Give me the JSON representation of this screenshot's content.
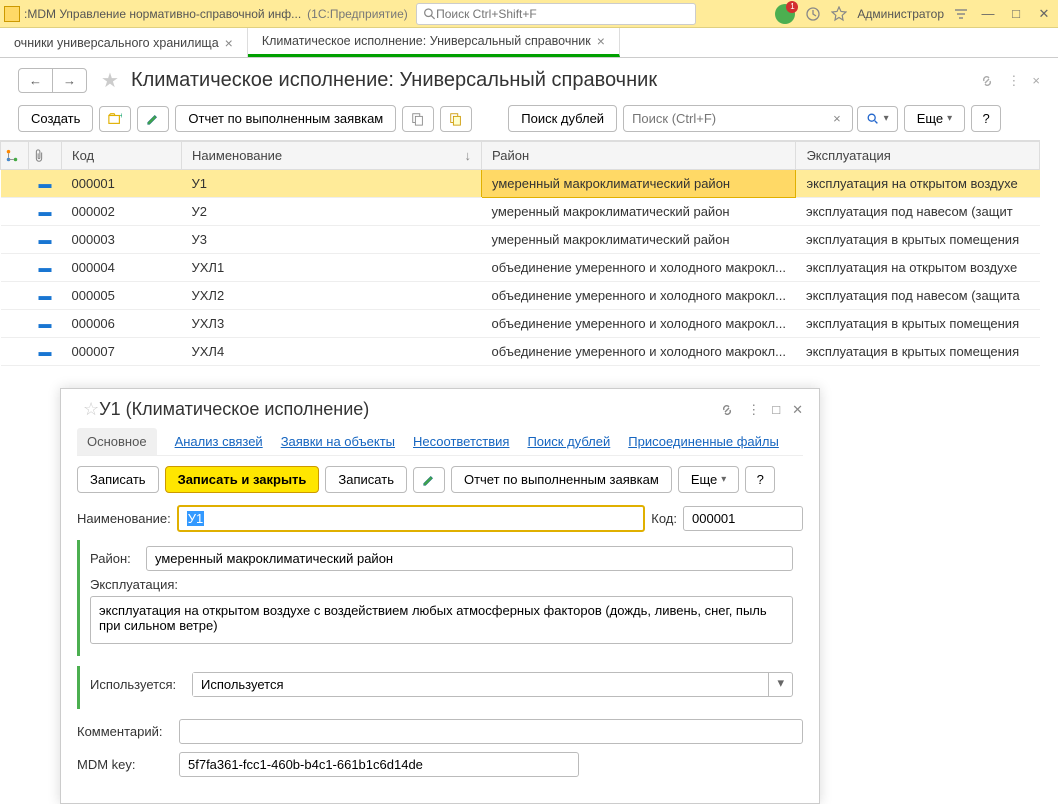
{
  "titlebar": {
    "app_title": ":MDM Управление нормативно-справочной инф...",
    "suffix": "(1С:Предприятие)",
    "search_placeholder": "Поиск Ctrl+Shift+F",
    "bell_badge": "1",
    "admin": "Администратор"
  },
  "tabs": [
    {
      "label": "очники универсального хранилища",
      "active": false
    },
    {
      "label": "Климатическое исполнение: Универсальный справочник",
      "active": true
    }
  ],
  "page": {
    "title": "Климатическое исполнение: Универсальный справочник"
  },
  "toolbar": {
    "create": "Создать",
    "report": "Отчет по выполненным заявкам",
    "dup_search": "Поиск дублей",
    "search_placeholder": "Поиск (Ctrl+F)",
    "more": "Еще"
  },
  "table": {
    "headers": {
      "code": "Код",
      "name": "Наименование",
      "rayon": "Район",
      "exp": "Эксплуатация"
    },
    "rows": [
      {
        "code": "000001",
        "name": "У1",
        "rayon": "умеренный макроклиматический район",
        "exp": "эксплуатация на открытом воздухе",
        "selected": true
      },
      {
        "code": "000002",
        "name": "У2",
        "rayon": "умеренный макроклиматический район",
        "exp": " эксплуатация под навесом (защит"
      },
      {
        "code": "000003",
        "name": "У3",
        "rayon": "умеренный макроклиматический район",
        "exp": "эксплуатация в крытых помещения"
      },
      {
        "code": "000004",
        "name": "УХЛ1",
        "rayon": "объединение умеренного и холодного макрокл...",
        "exp": "эксплуатация на открытом воздухе"
      },
      {
        "code": "000005",
        "name": "УХЛ2",
        "rayon": "объединение умеренного и холодного макрокл...",
        "exp": "эксплуатация под навесом (защита"
      },
      {
        "code": "000006",
        "name": "УХЛ3",
        "rayon": "объединение умеренного и холодного макрокл...",
        "exp": "эксплуатация в крытых помещения"
      },
      {
        "code": "000007",
        "name": "УХЛ4",
        "rayon": "объединение умеренного и холодного макрокл...",
        "exp": "эксплуатация в крытых помещения"
      }
    ]
  },
  "detail": {
    "title": "У1 (Климатическое исполнение)",
    "tabs": {
      "main": "Основное",
      "analysis": "Анализ связей",
      "requests": "Заявки на объекты",
      "nesoot": "Несоответствия",
      "dup": "Поиск дублей",
      "files": "Присоединенные файлы"
    },
    "btns": {
      "write": "Записать",
      "write_close": "Записать и закрыть",
      "write2": "Записать",
      "report": "Отчет по выполненным заявкам",
      "more": "Еще"
    },
    "labels": {
      "name": "Наименование:",
      "code": "Код:",
      "rayon": "Район:",
      "exp": "Эксплуатация:",
      "used": "Используется:",
      "comment": "Комментарий:",
      "mdm": "MDM key:"
    },
    "values": {
      "name": "У1",
      "code": "000001",
      "rayon": "умеренный макроклиматический район",
      "exp": "эксплуатация на открытом воздухе с воздействием любых атмосферных факторов (дождь, ливень, снег, пыль при сильном ветре)",
      "used": "Используется",
      "comment": "",
      "mdm": "5f7fa361-fcc1-460b-b4c1-661b1c6d14de"
    }
  }
}
